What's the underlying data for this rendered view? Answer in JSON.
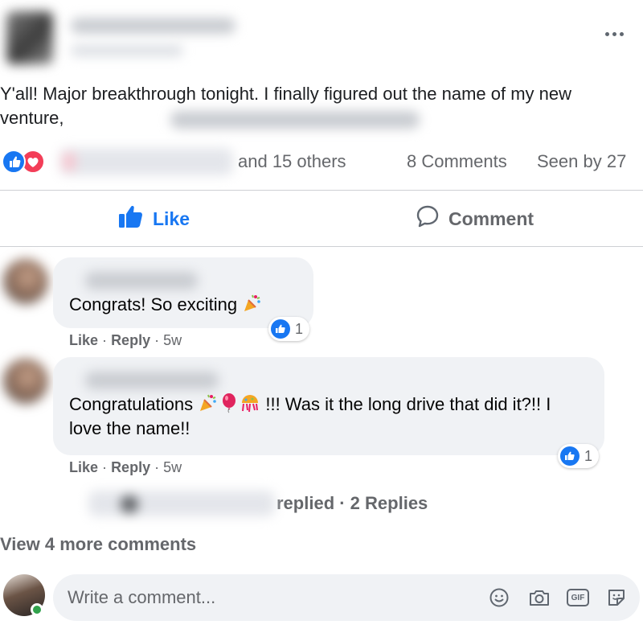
{
  "post": {
    "text": "Y'all! Major breakthrough tonight. I finally figured out the name of my new venture,",
    "more_label": "More options",
    "reactions_others": "and 15 others",
    "comments_count": "8 Comments",
    "seen_by": "Seen by 27",
    "reaction_icons": [
      "like-icon",
      "love-icon"
    ]
  },
  "actions": {
    "like_label": "Like",
    "comment_label": "Comment"
  },
  "comments": [
    {
      "text": "Congrats! So exciting",
      "emojis": [
        "party-popper-icon"
      ],
      "like": "Like",
      "reply": "Reply",
      "time": "5w",
      "reaction_count": "1"
    },
    {
      "text_before": "Congratulations",
      "emojis": [
        "party-popper-icon",
        "balloon-icon",
        "confetti-ball-icon"
      ],
      "text_after": " !!! Was it the long drive that did it?!! I love the name!!",
      "like": "Like",
      "reply": "Reply",
      "time": "5w",
      "reaction_count": "1",
      "replies_text": "replied · 2 Replies"
    }
  ],
  "view_more": "View 4 more comments",
  "composer": {
    "placeholder": "Write a comment...",
    "tools": [
      "emoji-icon",
      "camera-icon",
      "gif-icon",
      "sticker-icon"
    ],
    "gif_label": "GIF"
  },
  "colors": {
    "accent": "#1877f2",
    "love": "#f33e58",
    "muted_text": "#65676b",
    "bubble": "#f0f2f5",
    "online": "#31a24c"
  }
}
